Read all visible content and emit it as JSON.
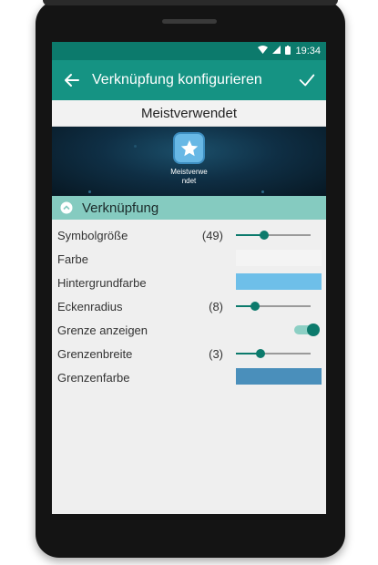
{
  "status_bar": {
    "time": "19:34"
  },
  "app_bar": {
    "title": "Verknüpfung konfigurieren"
  },
  "shortcut": {
    "name": "Meistverwendet",
    "label_line1": "Meistverwe",
    "label_line2": "ndet"
  },
  "section": {
    "title": "Verknüpfung"
  },
  "settings": {
    "icon_size": {
      "label": "Symbolgröße",
      "value": "(49)",
      "fraction": 0.38
    },
    "color": {
      "label": "Farbe",
      "color": "#f4f4f4"
    },
    "background_color": {
      "label": "Hintergrundfarbe",
      "color": "#6ebfe9"
    },
    "corner_radius": {
      "label": "Eckenradius",
      "value": "(8)",
      "fraction": 0.25
    },
    "show_border": {
      "label": "Grenze anzeigen",
      "enabled": true
    },
    "border_width": {
      "label": "Grenzenbreite",
      "value": "(3)",
      "fraction": 0.33
    },
    "border_color": {
      "label": "Grenzenfarbe",
      "color": "#4a8fbb"
    }
  },
  "colors": {
    "accent": "#159383",
    "accent_dark": "#0c7a6c",
    "section_bg": "#85cbc0"
  }
}
